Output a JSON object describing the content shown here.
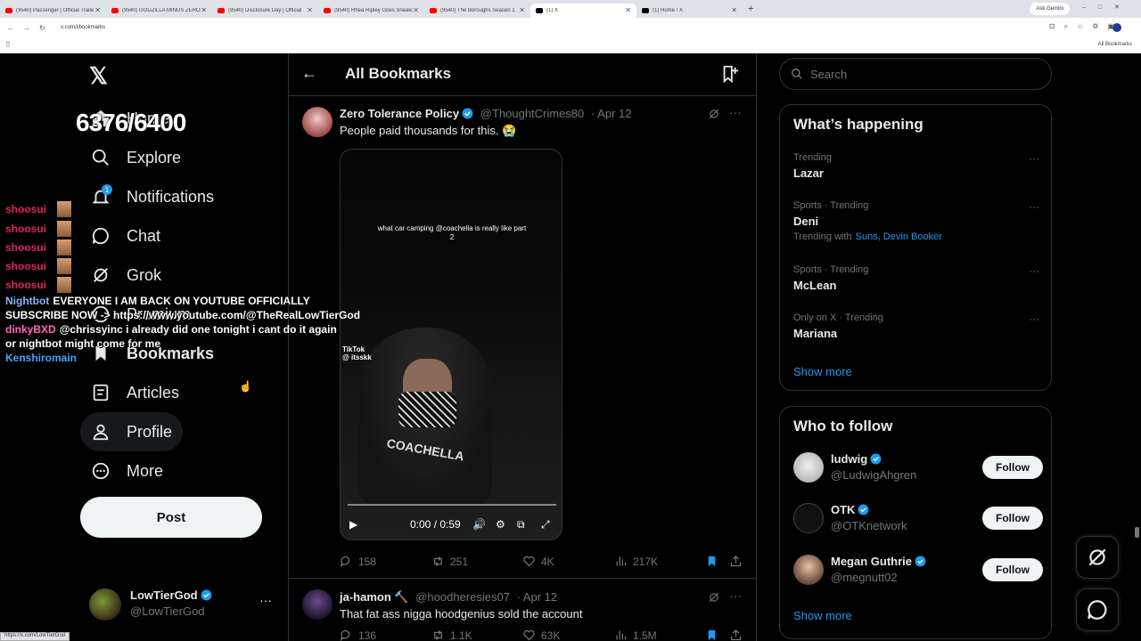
{
  "browser": {
    "tabs": [
      {
        "title": "(9540) Passenger | Official Traile",
        "icon": "youtube-icon"
      },
      {
        "title": "(9540) GODZILLA MINUS ZERO",
        "icon": "youtube-icon"
      },
      {
        "title": "(9540) Disclosure Day | Official",
        "icon": "youtube-icon"
      },
      {
        "title": "(9540) Rhea Ripley Goes Sneaki",
        "icon": "youtube-icon"
      },
      {
        "title": "(9540) The Boroughs Season 1",
        "icon": "youtube-icon"
      },
      {
        "title": "(1) X",
        "icon": "x-icon",
        "active": true
      },
      {
        "title": "(1) Home / X",
        "icon": "x-icon"
      }
    ],
    "ask_gemini": "Ask Gemini",
    "url": "x.com/i/bookmarks",
    "bookmarks_bar_label": "All Bookmarks",
    "status_url": "https://x.com/LowTierGod"
  },
  "nav": {
    "items": [
      {
        "label": "Home",
        "icon": "home-icon"
      },
      {
        "label": "Explore",
        "icon": "search-icon"
      },
      {
        "label": "Notifications",
        "icon": "bell-icon",
        "badge": "1"
      },
      {
        "label": "Chat",
        "icon": "chat-icon"
      },
      {
        "label": "Grok",
        "icon": "grok-icon"
      },
      {
        "label": "Premium",
        "icon": "premium-icon"
      },
      {
        "label": "Bookmarks",
        "icon": "bookmark-icon"
      },
      {
        "label": "Articles",
        "icon": "articles-icon"
      },
      {
        "label": "Profile",
        "icon": "profile-icon"
      },
      {
        "label": "More",
        "icon": "more-circle-icon"
      }
    ],
    "post_label": "Post",
    "account": {
      "name": "LowTierGod",
      "handle": "@LowTierGod",
      "more": "···"
    }
  },
  "overlay": {
    "counter": "6376/6400",
    "chat": [
      {
        "user": "shoosui"
      },
      {
        "user": "shoosui"
      },
      {
        "user": "shoosui"
      },
      {
        "user": "shoosui"
      },
      {
        "user": "shoosui"
      }
    ],
    "messages": [
      {
        "user": "Nightbot",
        "text": "EVERYONE I AM BACK ON YOUTUBE OFFICIALLY",
        "text2": "SUBSCRIBE NOW -> https://www.youtube.com/@TheRealLowTierGod"
      },
      {
        "user": "dinkyBXD",
        "text": "@chrissyinc i already did one tonight i cant do it again",
        "text2": "or nightbot might come for me"
      },
      {
        "user": "Kenshiromain",
        "text": ""
      }
    ]
  },
  "center": {
    "title": "All Bookmarks",
    "tweets": [
      {
        "name": "Zero Tolerance Policy",
        "handle": "@ThoughtCrimes80",
        "date": "· Apr 12",
        "text": "People paid thousands for this. 😭",
        "video": {
          "caption": "what car camping @coachella is really like part 2",
          "watermark": "TikTok",
          "watermark_user": "@ itsskk",
          "shirt_text": "COACHELLA",
          "time": "0:00 / 0:59",
          "progress": 0
        },
        "replies": "158",
        "reposts": "251",
        "likes": "4K",
        "views": "217K"
      },
      {
        "name": "ja-hamon 🔨",
        "handle": "@hoodheresies07",
        "date": "· Apr 12",
        "text": "That fat ass nigga hoodgenius sold the account",
        "replies": "136",
        "reposts": "1.1K",
        "likes": "63K",
        "views": "1.5M"
      }
    ]
  },
  "right": {
    "search_placeholder": "Search",
    "happening": {
      "title": "What’s happening",
      "trends": [
        {
          "meta": "Trending",
          "name": "Lazar"
        },
        {
          "meta": "Sports · Trending",
          "name": "Deni",
          "sub": "Trending with",
          "links": "Suns, Devin Booker"
        },
        {
          "meta": "Sports · Trending",
          "name": "McLean"
        },
        {
          "meta": "Only on X · Trending",
          "name": "Mariana"
        }
      ],
      "show_more": "Show more"
    },
    "who_to_follow": {
      "title": "Who to follow",
      "accounts": [
        {
          "name": "ludwig",
          "handle": "@LudwigAhgren",
          "button": "Follow"
        },
        {
          "name": "OTK",
          "handle": "@OTKnetwork",
          "button": "Follow"
        },
        {
          "name": "Megan Guthrie",
          "handle": "@megnutt02",
          "button": "Follow"
        }
      ],
      "show_more": "Show more"
    }
  },
  "colors": {
    "accent": "#1d9bf0",
    "background": "#000000",
    "border": "#2f3336",
    "muted": "#71767b"
  }
}
